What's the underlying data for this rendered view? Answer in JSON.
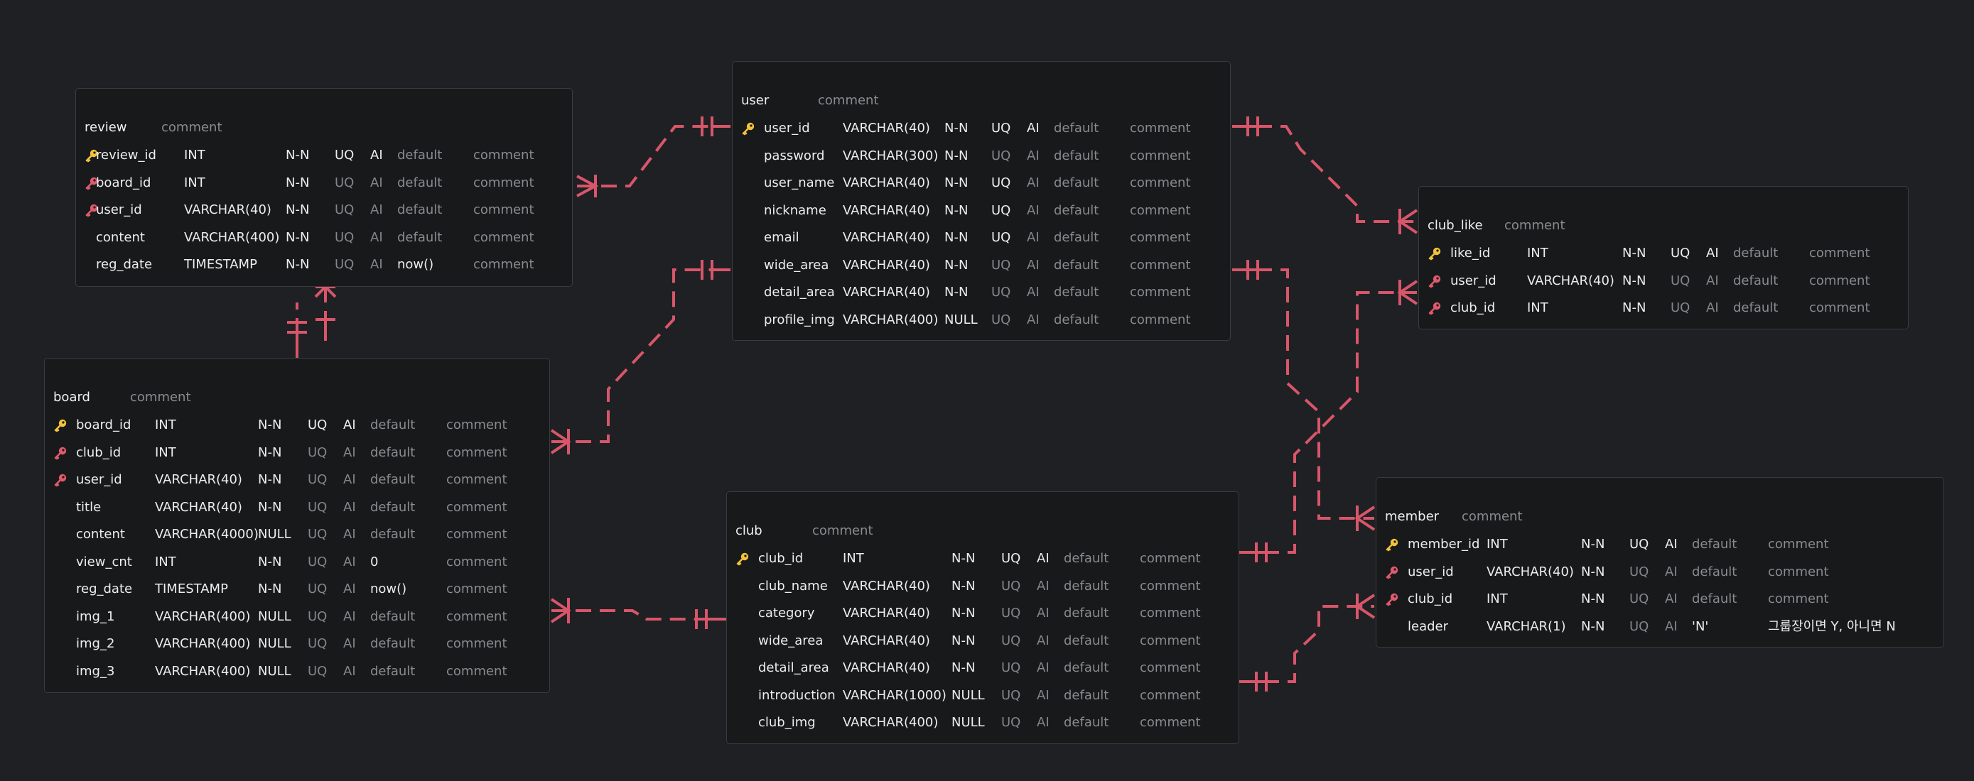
{
  "colors": {
    "background": "#1f2023",
    "entity_bg": "#18191b",
    "relation": "#d8566a",
    "primary_key": "#f2c23a",
    "foreign_key": "#e05a6e",
    "muted_text": "#85868a"
  },
  "entities": {
    "review": {
      "name": "review",
      "comment": "comment",
      "columns": [
        {
          "key": "primary-key",
          "name": "review_id",
          "type": "INT",
          "nn": "N-N",
          "uq": "UQ",
          "ai": "AI",
          "default": "default",
          "comment": "comment"
        },
        {
          "key": "foreign-key",
          "name": "board_id",
          "type": "INT",
          "nn": "N-N",
          "uq": "UQ",
          "ai": "AI",
          "default": "default",
          "comment": "comment"
        },
        {
          "key": "foreign-key",
          "name": "user_id",
          "type": "VARCHAR(40)",
          "nn": "N-N",
          "uq": "UQ",
          "ai": "AI",
          "default": "default",
          "comment": "comment"
        },
        {
          "key": "none",
          "name": "content",
          "type": "VARCHAR(400)",
          "nn": "N-N",
          "uq": "UQ",
          "ai": "AI",
          "default": "default",
          "comment": "comment"
        },
        {
          "key": "none",
          "name": "reg_date",
          "type": "TIMESTAMP",
          "nn": "N-N",
          "uq": "UQ",
          "ai": "AI",
          "default": "now()",
          "comment": "comment"
        }
      ]
    },
    "user": {
      "name": "user",
      "comment": "comment",
      "columns": [
        {
          "key": "primary-key",
          "name": "user_id",
          "type": "VARCHAR(40)",
          "nn": "N-N",
          "uq": "UQ",
          "ai": "AI",
          "default": "default",
          "comment": "comment"
        },
        {
          "key": "none",
          "name": "password",
          "type": "VARCHAR(300)",
          "nn": "N-N",
          "uq": "UQ",
          "ai": "AI",
          "default": "default",
          "comment": "comment"
        },
        {
          "key": "none",
          "name": "user_name",
          "type": "VARCHAR(40)",
          "nn": "N-N",
          "uq": "UQ",
          "ai": "AI",
          "default": "default",
          "comment": "comment"
        },
        {
          "key": "none",
          "name": "nickname",
          "type": "VARCHAR(40)",
          "nn": "N-N",
          "uq": "UQ",
          "ai": "AI",
          "default": "default",
          "comment": "comment"
        },
        {
          "key": "none",
          "name": "email",
          "type": "VARCHAR(40)",
          "nn": "N-N",
          "uq": "UQ",
          "ai": "AI",
          "default": "default",
          "comment": "comment"
        },
        {
          "key": "none",
          "name": "wide_area",
          "type": "VARCHAR(40)",
          "nn": "N-N",
          "uq": "UQ",
          "ai": "AI",
          "default": "default",
          "comment": "comment"
        },
        {
          "key": "none",
          "name": "detail_area",
          "type": "VARCHAR(40)",
          "nn": "N-N",
          "uq": "UQ",
          "ai": "AI",
          "default": "default",
          "comment": "comment"
        },
        {
          "key": "none",
          "name": "profile_img",
          "type": "VARCHAR(400)",
          "nn": "NULL",
          "uq": "UQ",
          "ai": "AI",
          "default": "default",
          "comment": "comment"
        }
      ]
    },
    "club_like": {
      "name": "club_like",
      "comment": "comment",
      "columns": [
        {
          "key": "primary-key",
          "name": "like_id",
          "type": "INT",
          "nn": "N-N",
          "uq": "UQ",
          "ai": "AI",
          "default": "default",
          "comment": "comment"
        },
        {
          "key": "foreign-key",
          "name": "user_id",
          "type": "VARCHAR(40)",
          "nn": "N-N",
          "uq": "UQ",
          "ai": "AI",
          "default": "default",
          "comment": "comment"
        },
        {
          "key": "foreign-key",
          "name": "club_id",
          "type": "INT",
          "nn": "N-N",
          "uq": "UQ",
          "ai": "AI",
          "default": "default",
          "comment": "comment"
        }
      ]
    },
    "board": {
      "name": "board",
      "comment": "comment",
      "columns": [
        {
          "key": "primary-key",
          "name": "board_id",
          "type": "INT",
          "nn": "N-N",
          "uq": "UQ",
          "ai": "AI",
          "default": "default",
          "comment": "comment"
        },
        {
          "key": "foreign-key",
          "name": "club_id",
          "type": "INT",
          "nn": "N-N",
          "uq": "UQ",
          "ai": "AI",
          "default": "default",
          "comment": "comment"
        },
        {
          "key": "foreign-key",
          "name": "user_id",
          "type": "VARCHAR(40)",
          "nn": "N-N",
          "uq": "UQ",
          "ai": "AI",
          "default": "default",
          "comment": "comment"
        },
        {
          "key": "none",
          "name": "title",
          "type": "VARCHAR(40)",
          "nn": "N-N",
          "uq": "UQ",
          "ai": "AI",
          "default": "default",
          "comment": "comment"
        },
        {
          "key": "none",
          "name": "content",
          "type": "VARCHAR(4000)",
          "nn": "NULL",
          "uq": "UQ",
          "ai": "AI",
          "default": "default",
          "comment": "comment"
        },
        {
          "key": "none",
          "name": "view_cnt",
          "type": "INT",
          "nn": "N-N",
          "uq": "UQ",
          "ai": "AI",
          "default": "0",
          "comment": "comment"
        },
        {
          "key": "none",
          "name": "reg_date",
          "type": "TIMESTAMP",
          "nn": "N-N",
          "uq": "UQ",
          "ai": "AI",
          "default": "now()",
          "comment": "comment"
        },
        {
          "key": "none",
          "name": "img_1",
          "type": "VARCHAR(400)",
          "nn": "NULL",
          "uq": "UQ",
          "ai": "AI",
          "default": "default",
          "comment": "comment"
        },
        {
          "key": "none",
          "name": "img_2",
          "type": "VARCHAR(400)",
          "nn": "NULL",
          "uq": "UQ",
          "ai": "AI",
          "default": "default",
          "comment": "comment"
        },
        {
          "key": "none",
          "name": "img_3",
          "type": "VARCHAR(400)",
          "nn": "NULL",
          "uq": "UQ",
          "ai": "AI",
          "default": "default",
          "comment": "comment"
        }
      ]
    },
    "club": {
      "name": "club",
      "comment": "comment",
      "columns": [
        {
          "key": "primary-key",
          "name": "club_id",
          "type": "INT",
          "nn": "N-N",
          "uq": "UQ",
          "ai": "AI",
          "default": "default",
          "comment": "comment"
        },
        {
          "key": "none",
          "name": "club_name",
          "type": "VARCHAR(40)",
          "nn": "N-N",
          "uq": "UQ",
          "ai": "AI",
          "default": "default",
          "comment": "comment"
        },
        {
          "key": "none",
          "name": "category",
          "type": "VARCHAR(40)",
          "nn": "N-N",
          "uq": "UQ",
          "ai": "AI",
          "default": "default",
          "comment": "comment"
        },
        {
          "key": "none",
          "name": "wide_area",
          "type": "VARCHAR(40)",
          "nn": "N-N",
          "uq": "UQ",
          "ai": "AI",
          "default": "default",
          "comment": "comment"
        },
        {
          "key": "none",
          "name": "detail_area",
          "type": "VARCHAR(40)",
          "nn": "N-N",
          "uq": "UQ",
          "ai": "AI",
          "default": "default",
          "comment": "comment"
        },
        {
          "key": "none",
          "name": "introduction",
          "type": "VARCHAR(1000)",
          "nn": "NULL",
          "uq": "UQ",
          "ai": "AI",
          "default": "default",
          "comment": "comment"
        },
        {
          "key": "none",
          "name": "club_img",
          "type": "VARCHAR(400)",
          "nn": "NULL",
          "uq": "UQ",
          "ai": "AI",
          "default": "default",
          "comment": "comment"
        }
      ]
    },
    "member": {
      "name": "member",
      "comment": "comment",
      "columns": [
        {
          "key": "primary-key",
          "name": "member_id",
          "type": "INT",
          "nn": "N-N",
          "uq": "UQ",
          "ai": "AI",
          "default": "default",
          "comment": "comment"
        },
        {
          "key": "foreign-key",
          "name": "user_id",
          "type": "VARCHAR(40)",
          "nn": "N-N",
          "uq": "UQ",
          "ai": "AI",
          "default": "default",
          "comment": "comment"
        },
        {
          "key": "foreign-key",
          "name": "club_id",
          "type": "INT",
          "nn": "N-N",
          "uq": "UQ",
          "ai": "AI",
          "default": "default",
          "comment": "comment"
        },
        {
          "key": "none",
          "name": "leader",
          "type": "VARCHAR(1)",
          "nn": "N-N",
          "uq": "UQ",
          "ai": "AI",
          "default": "'N'",
          "comment": "그룹장이면 Y, 아니면 N"
        }
      ]
    }
  }
}
